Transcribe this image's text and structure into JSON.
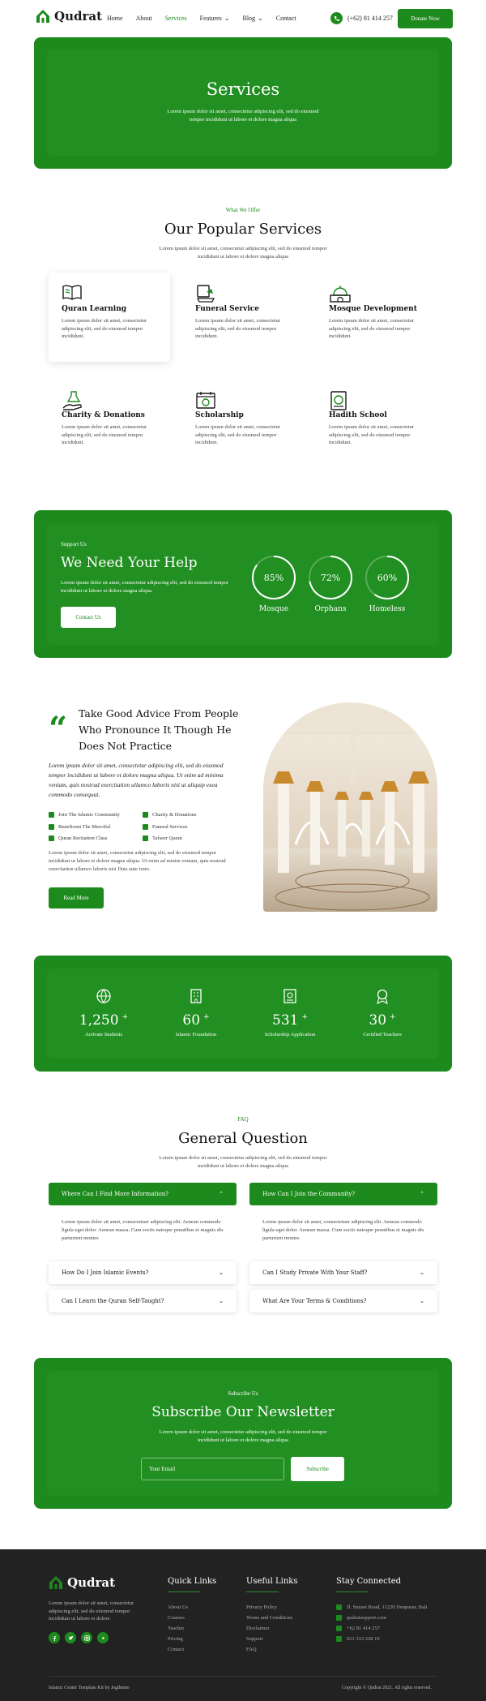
{
  "brand": {
    "name": "Qudrat"
  },
  "nav": {
    "items": [
      "Home",
      "About",
      "Services",
      "Features",
      "Blog",
      "Contact"
    ],
    "phone": "(+62) 81 414 257",
    "donate": "Donate Now"
  },
  "hero": {
    "title": "Services",
    "subtitle": "Lorem ipsum dolor sit amet, consectetur adipiscing elit, sed do eiusmod tempor incididunt ut labore et dolore magna aliqua"
  },
  "services": {
    "kicker": "What We Offer",
    "title": "Our Popular Services",
    "subtitle": "Lorem ipsum dolor sit amet, consectetur adipiscing elit, sed do eiusmod tempor incididunt ut labore et dolore magna aliqua",
    "items": [
      {
        "title": "Quran Learning",
        "desc": "Lorem ipsum dolor sit amet, consectetur adipiscing elit, sed do eiusmod tempor incididunt.",
        "icon": "quran-book-icon"
      },
      {
        "title": "Funeral Service",
        "desc": "Lorem ipsum dolor sit amet, consectetur adipiscing elit, sed do eiusmod tempor incididunt.",
        "icon": "funeral-icon"
      },
      {
        "title": "Mosque Development",
        "desc": "Lorem ipsum dolor sit amet, consectetur adipiscing elit, sed do eiusmod tempor incididunt.",
        "icon": "mosque-icon"
      },
      {
        "title": "Charity & Donations",
        "desc": "Lorem ipsum dolor sit amet, consectetur adipiscing elit, sed do eiusmod tempor incididunt.",
        "icon": "charity-icon"
      },
      {
        "title": "Scholarship",
        "desc": "Lorem ipsum dolor sit amet, consectetur adipiscing elit, sed do eiusmod tempor incididunt.",
        "icon": "scholarship-icon"
      },
      {
        "title": "Hadith School",
        "desc": "Lorem ipsum dolor sit amet, consectetur adipiscing elit, sed do eiusmod tempor incididunt.",
        "icon": "hadith-book-icon"
      }
    ]
  },
  "support": {
    "kicker": "Support Us",
    "title": "We Need Your Help",
    "desc": "Lorem ipsum dolor sit amet, consectetur adipiscing elit, sed do eiusmod tempor incididunt ut labore et dolore magna aliqua.",
    "button": "Contact Us",
    "stats": [
      {
        "value": "85%",
        "label": "Mosque",
        "pct": 0.85
      },
      {
        "value": "72%",
        "label": "Orphans",
        "pct": 0.72
      },
      {
        "value": "60%",
        "label": "Homeless",
        "pct": 0.6
      }
    ]
  },
  "advice": {
    "title": "Take Good Advice From People Who Pronounce It Though He Does Not Practice",
    "intro": "Lorem ipsum dolor sit amet, consectetur adipiscing elit, sed do eiusmod tempor incididunt ut labore et dolore magna aliqua. Ut enim ad minima veniam, quis nostrud exercitation ullamco laboris nisi ut aliquip exea commodo consequat.",
    "checks": [
      "Join The Islamic Community",
      "Charity & Donations",
      "Beneficent The Merciful",
      "Funeral Services",
      "Quran Recitation Class",
      "Tafseer Quran"
    ],
    "desc": "Lorem ipsum dolor sit amet, consectetur adipiscing elit, sed do eiusmod tempor incididunt ut labore et dolore magna aliqua. Ut enim ad minim veniam, quis nostrud exercitation ullamco laboris nisi Duis aute irure.",
    "button": "Read More"
  },
  "stats": [
    {
      "num": "1,250",
      "plus": "+",
      "label": "Activate Students",
      "icon": "globe-icon"
    },
    {
      "num": "60",
      "plus": "+",
      "label": "Islamic Foundation",
      "icon": "building-icon"
    },
    {
      "num": "531",
      "plus": "+",
      "label": "Scholarship Application",
      "icon": "certificate-icon"
    },
    {
      "num": "30",
      "plus": "+",
      "label": "Certified Teachers",
      "icon": "award-icon"
    }
  ],
  "faq": {
    "kicker": "FAQ",
    "title": "General Question",
    "subtitle": "Lorem ipsum dolor sit amet, consectetur adipiscing elit, sed do eiusmod tempor incididunt ut labore et dolore magna aliqua",
    "items": [
      {
        "q": "Where Can I Find More Information?",
        "a": "Lorem ipsum dolor sit amet, consectetuer adipiscing elit. Aenean commodo ligula eget dolor. Aenean massa. Cum sociis natoque penatibus et magnis dis parturient montes"
      },
      {
        "q": "How Can I Join the Community?",
        "a": "Lorem ipsum dolor sit amet, consectetuer adipiscing elit. Aenean commodo ligula eget dolor. Aenean massa. Cum sociis natoque penatibus et magnis dis parturient montes"
      },
      {
        "q": "How Do I Join Islamic Events?"
      },
      {
        "q": "Can I Study Private With Your Staff?"
      },
      {
        "q": "Can I Learn the Quran Self-Taught?"
      },
      {
        "q": "What Are Your Terms & Conditions?"
      }
    ]
  },
  "newsletter": {
    "kicker": "Subscribe Us",
    "title": "Subscribe Our Newsletter",
    "subtitle": "Lorem ipsum dolor sit amet, consectetur adipiscing elit, sed do eiusmod tempor incididunt ut labore et dolore magna aliqua",
    "placeholder": "Your Email",
    "button": "Subscribe"
  },
  "footer": {
    "desc": "Lorem ipsum dolor sit amet, consectetur adipiscing elit, sed do eiusmod tempor incididunt ut labore et dolore",
    "quick_title": "Quick Links",
    "quick": [
      "About Us",
      "Courses",
      "Teacher",
      "Pricing",
      "Contact"
    ],
    "useful_title": "Useful Links",
    "useful": [
      "Privacy Policy",
      "Terms and Conditions",
      "Disclaimer",
      "Support",
      "FAQ"
    ],
    "connect_title": "Stay Connected",
    "connect": [
      "Jl. Sunset Road, 11220 Denpasar, Bali",
      "qudratsupport.com",
      "+62 81 414 257",
      "021 333 228 19"
    ],
    "credit": "Islamic Center Template Kit by Jegtheme",
    "copyright": "Copyright © Qudrat 2021. All rights reserved."
  },
  "colors": {
    "primary": "#1d8a1d",
    "footer": "#222222"
  }
}
